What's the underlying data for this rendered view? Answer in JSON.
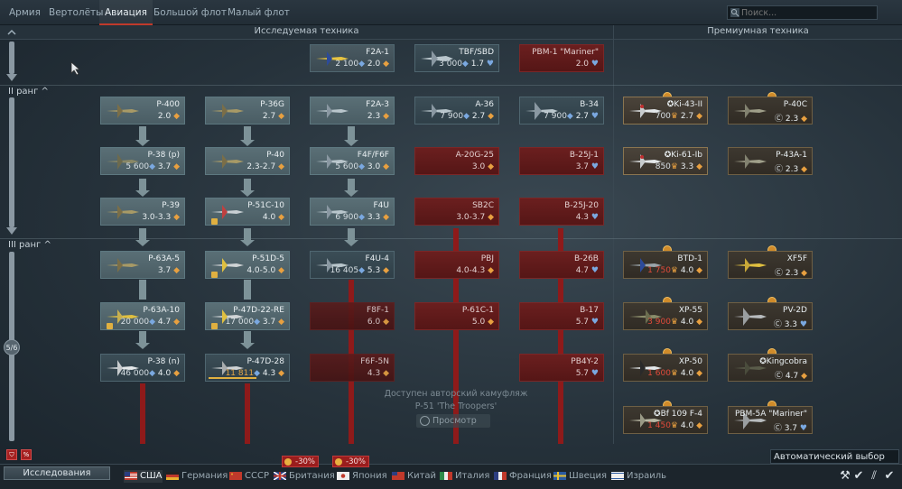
{
  "tabs": [
    {
      "label": "Армия",
      "active": false
    },
    {
      "label": "Вертолёты",
      "active": false
    },
    {
      "label": "Авиация",
      "active": true
    },
    {
      "label": "Большой флот",
      "active": false
    },
    {
      "label": "Малый флот",
      "active": false
    }
  ],
  "search": {
    "placeholder": "Поиск..."
  },
  "sections": {
    "researched": "Исследуемая техника",
    "premium": "Премиумная техника"
  },
  "ranks": {
    "r2": "II ранг",
    "r3": "III ранг"
  },
  "page_indicator": "5/6",
  "vehicles": {
    "top_f2a1": {
      "name": "F2A-1",
      "rp": "2 100",
      "br": "2.0"
    },
    "top_tbf": {
      "name": "TBF/SBD",
      "rp": "3 000",
      "br": "1.7"
    },
    "top_pbm1": {
      "name": "PBM-1 \"Mariner\"",
      "br": "2.0"
    },
    "p400": {
      "name": "P-400",
      "br": "2.0"
    },
    "p36g": {
      "name": "P-36G",
      "br": "2.7"
    },
    "f2a3": {
      "name": "F2A-3",
      "br": "2.3"
    },
    "a36": {
      "name": "A-36",
      "rp": "7 900",
      "br": "2.7"
    },
    "b34": {
      "name": "B-34",
      "rp": "7 900",
      "br": "2.7"
    },
    "p38p": {
      "name": "P-38 (р)",
      "rp": "5 600",
      "br": "3.7"
    },
    "p40": {
      "name": "P-40",
      "br": "2.3-2.7"
    },
    "f4f": {
      "name": "F4F/F6F",
      "rp": "5 600",
      "br": "3.0"
    },
    "a20g": {
      "name": "A-20G-25",
      "br": "3.0"
    },
    "b25j1": {
      "name": "B-25J-1",
      "br": "3.7"
    },
    "p39": {
      "name": "P-39",
      "br": "3.0-3.3"
    },
    "p51c": {
      "name": "P-51C-10",
      "br": "4.0"
    },
    "f4u": {
      "name": "F4U",
      "rp": "6 900",
      "br": "3.3"
    },
    "sb2c": {
      "name": "SB2C",
      "br": "3.0-3.7"
    },
    "b25j20": {
      "name": "B-25J-20",
      "br": "4.3"
    },
    "p63a5": {
      "name": "P-63A-5",
      "br": "3.7"
    },
    "p51d5": {
      "name": "P-51D-5",
      "br": "4.0-5.0"
    },
    "f4u4": {
      "name": "F4U-4",
      "rp": "16 405",
      "br": "5.3"
    },
    "pbj": {
      "name": "PBJ",
      "br": "4.0-4.3"
    },
    "b26b": {
      "name": "B-26B",
      "br": "4.7"
    },
    "p63a10": {
      "name": "P-63A-10",
      "rp": "20 000",
      "br": "4.7"
    },
    "p47d22": {
      "name": "P-47D-22-RE",
      "rp": "17 000",
      "br": "3.7"
    },
    "f8f1": {
      "name": "F8F-1",
      "br": "6.0"
    },
    "p61c1": {
      "name": "P-61C-1",
      "br": "5.0"
    },
    "b17": {
      "name": "B-17",
      "br": "5.7"
    },
    "p38n": {
      "name": "P-38 (n)",
      "rp": "46 000",
      "br": "4.0"
    },
    "p47d28": {
      "name": "P-47D-28",
      "rp": "11 811",
      "br": "4.3",
      "progress": 0.6
    },
    "f6f5n": {
      "name": "F6F-5N",
      "br": "4.3"
    },
    "pb4y2": {
      "name": "PB4Y-2",
      "br": "5.7"
    },
    "ki43": {
      "name": "Ki-43-II",
      "price": "700",
      "br": "2.7"
    },
    "p40c": {
      "name": "P-40C",
      "br": "2.3"
    },
    "ki61": {
      "name": "Ki-61-Ib",
      "price": "850",
      "br": "3.3"
    },
    "p43a1": {
      "name": "P-43A-1",
      "br": "2.3"
    },
    "btd1": {
      "name": "BTD-1",
      "price": "1 750",
      "br": "4.0"
    },
    "xf5f": {
      "name": "XF5F",
      "br": "2.3"
    },
    "xp55": {
      "name": "XP-55",
      "price": "3 900",
      "br": "4.0"
    },
    "pv2d": {
      "name": "PV-2D",
      "br": "3.3"
    },
    "xp50": {
      "name": "XP-50",
      "price": "1 600",
      "br": "4.0"
    },
    "kingcobra": {
      "name": "Kingcobra",
      "br": "4.7"
    },
    "bf109": {
      "name": "Bf 109 F-4",
      "price": "1 450",
      "br": "4.0"
    },
    "pbm5a": {
      "name": "PBM-5A \"Mariner\"",
      "br": "3.7"
    }
  },
  "camo": {
    "line1": "Доступен авторский камуфляж",
    "line2": "P-51 'The Troopers'",
    "button": "Просмотр"
  },
  "bottom": {
    "research_button": "Исследования",
    "nations": [
      "США",
      "Германия",
      "СССР",
      "Британия",
      "Япония",
      "Китай",
      "Италия",
      "Франция",
      "Швеция",
      "Израиль"
    ],
    "discount1": "-30%",
    "discount2": "-30%",
    "badge_percent": "%",
    "autoselect": "Автоматический выбор"
  },
  "colors": {
    "accent": "#c0392b",
    "rp": "#e0a548",
    "locked_red": "#6b1f1f",
    "premium_gold": "#d08b2a"
  }
}
